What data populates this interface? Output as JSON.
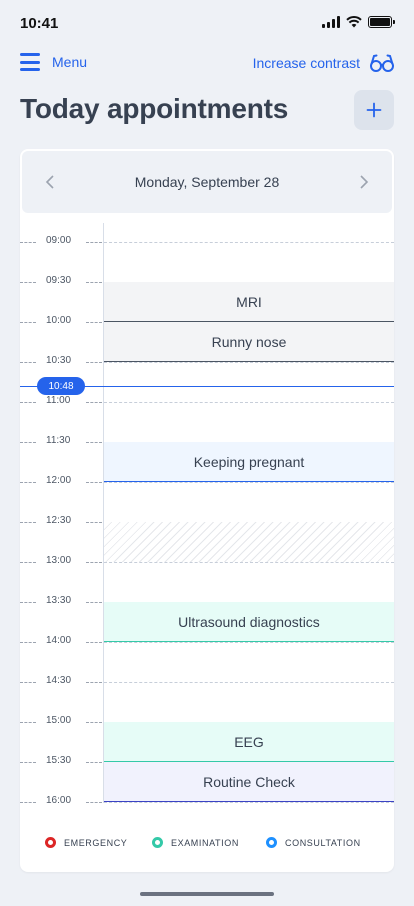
{
  "status_bar": {
    "time": "10:41"
  },
  "header": {
    "menu_label": "Menu",
    "contrast_label": "Increase contrast",
    "title": "Today appointments",
    "add_symbol": "+"
  },
  "date_nav": {
    "date": "Monday, September 28"
  },
  "times": [
    "09:00",
    "09:30",
    "10:00",
    "10:30",
    "11:00",
    "11:30",
    "12:00",
    "12:30",
    "13:00",
    "13:30",
    "14:00",
    "14:30",
    "15:00",
    "15:30",
    "16:00"
  ],
  "current_time": "10:48",
  "appointments": [
    {
      "title": "MRI",
      "start": "09:30",
      "end": "10:00",
      "category": "gray"
    },
    {
      "title": "Runny nose",
      "start": "10:00",
      "end": "10:30",
      "category": "gray"
    },
    {
      "title": "Keeping pregnant",
      "start": "11:30",
      "end": "12:00",
      "category": "consultation"
    },
    {
      "title": "",
      "start": "12:30",
      "end": "13:00",
      "category": "blocked"
    },
    {
      "title": "Ultrasound diagnostics",
      "start": "13:30",
      "end": "14:00",
      "category": "examination"
    },
    {
      "title": "EEG",
      "start": "15:00",
      "end": "15:30",
      "category": "examination"
    },
    {
      "title": "Routine Check",
      "start": "15:30",
      "end": "16:00",
      "category": "indigo"
    }
  ],
  "legend": [
    {
      "label": "EMERGENCY",
      "color": "#dc2626"
    },
    {
      "label": "EXAMINATION",
      "color": "#34c9a8"
    },
    {
      "label": "CONSULTATION",
      "color": "#1e90ff"
    }
  ],
  "colors": {
    "accent": "#2563eb"
  }
}
